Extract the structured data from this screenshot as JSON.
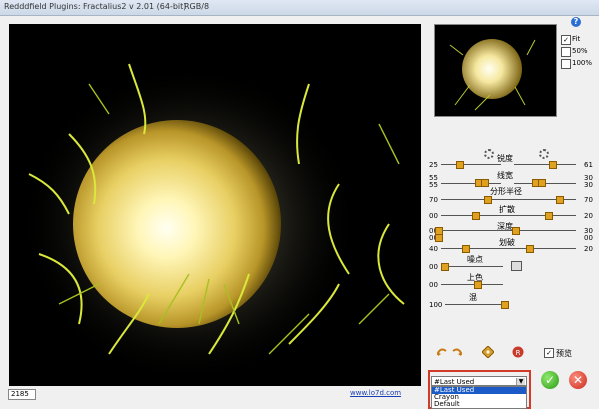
{
  "window": {
    "title": "Redddfield Plugins: Fractalius2 v 2.01 (64-bit)",
    "mode": "RGB/8"
  },
  "help": {
    "label": "?"
  },
  "zoom": {
    "fit_label": "Fit",
    "fit_checked": "✓",
    "fifty_label": "50%",
    "hundred_label": "100%"
  },
  "controls": {
    "sharpness_label": "锐度",
    "sharpness_left": "25",
    "sharpness_right": "61",
    "line_width_label": "线宽",
    "line_width_left": "55",
    "line_width_right": "30",
    "fractal_radius_label": "分形半径",
    "fractal_radius_left": "55",
    "fractal_radius_right": "30",
    "row4_left": "70",
    "row4_right": "70",
    "spread_label": "扩散",
    "spread_left": "00",
    "spread_right": "20",
    "depth_label": "深度",
    "depth_left": "00",
    "depth_right": "30",
    "row7_left": "00",
    "row7_right": "00",
    "blur_label": "划破",
    "blur_left": "40",
    "blur_right": "20",
    "noise_label": "噪点",
    "noise_left": "00",
    "color_label": "上色",
    "color_left": "00",
    "blend_label": "混",
    "blend_left": "100",
    "view_label": "预览",
    "view_checked": "✓"
  },
  "status": {
    "value": "2185"
  },
  "footer": {
    "url": "www.lo7d.com"
  },
  "preset": {
    "selected": "#Last Used",
    "options": [
      "#Last Used",
      "Crayon",
      "Default"
    ]
  },
  "buttons": {
    "ok": "✓",
    "cancel": "✕"
  }
}
